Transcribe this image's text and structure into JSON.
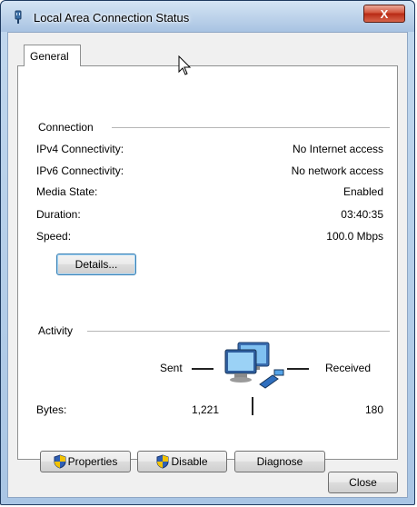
{
  "window": {
    "title": "Local Area Connection Status",
    "close_glyph": "X",
    "icon": "network-adapter-icon"
  },
  "tabs": [
    {
      "label": "General",
      "selected": true
    }
  ],
  "connection": {
    "group_title": "Connection",
    "rows": [
      {
        "label": "IPv4 Connectivity:",
        "value": "No Internet access"
      },
      {
        "label": "IPv6 Connectivity:",
        "value": "No network access"
      },
      {
        "label": "Media State:",
        "value": "Enabled"
      },
      {
        "label": "Duration:",
        "value": "03:40:35"
      },
      {
        "label": "Speed:",
        "value": "100.0 Mbps"
      }
    ],
    "details_button": "Details..."
  },
  "activity": {
    "group_title": "Activity",
    "sent_label": "Sent",
    "received_label": "Received",
    "bytes_label": "Bytes:",
    "bytes_sent": "1,221",
    "bytes_received": "180",
    "icon": "network-computers-icon"
  },
  "action_buttons": {
    "properties": "Properties",
    "disable": "Disable",
    "diagnose": "Diagnose"
  },
  "footer": {
    "close_label": "Close"
  },
  "colors": {
    "titlebar": "#bcd2ea",
    "close_button": "#c8432a",
    "shield_blue": "#2f5fb3",
    "shield_yellow": "#f2c200"
  }
}
